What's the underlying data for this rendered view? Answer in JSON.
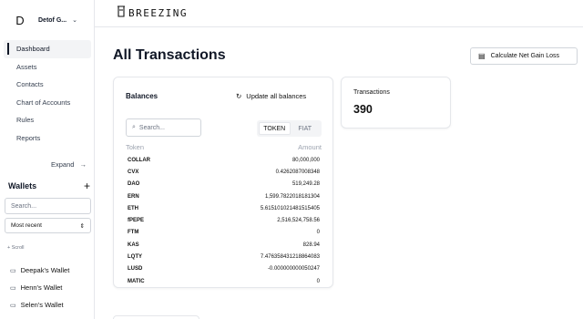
{
  "org": {
    "initial": "D",
    "name": "Detof G..."
  },
  "nav": [
    {
      "label": "Dashboard",
      "active": true
    },
    {
      "label": "Assets"
    },
    {
      "label": "Contacts"
    },
    {
      "label": "Chart of Accounts"
    },
    {
      "label": "Rules"
    },
    {
      "label": "Reports"
    }
  ],
  "sidebar": {
    "expand_label": "Expand",
    "wallets_title": "Wallets",
    "wallet_search_placeholder": "Search...",
    "sort_value": "Most recent",
    "scroll_hint": "+ Scroll",
    "wallets": [
      "Deepak's Wallet",
      "Henn's Wallet",
      "Selen's Wallet"
    ]
  },
  "brand": {
    "name": "BREEZING"
  },
  "main": {
    "title": "All Transactions",
    "calc_button": "Calculate Net Gain Loss"
  },
  "balances": {
    "title": "Balances",
    "update_label": "Update all balances",
    "search_placeholder": "Search...",
    "toggle": [
      "TOKEN",
      "FIAT"
    ],
    "toggle_selected": "TOKEN",
    "col_token": "Token",
    "col_amount": "Amount",
    "rows": [
      {
        "token": "COLLAR",
        "amount": "80,000,000"
      },
      {
        "token": "CVX",
        "amount": "0.4262087008348"
      },
      {
        "token": "DAO",
        "amount": "519,249.28"
      },
      {
        "token": "ERN",
        "amount": "1,599.7822018181304"
      },
      {
        "token": "ETH",
        "amount": "5.615101021481515405"
      },
      {
        "token": "fPEPE",
        "amount": "2,516,524,758.56"
      },
      {
        "token": "FTM",
        "amount": "0"
      },
      {
        "token": "KAS",
        "amount": "828.94"
      },
      {
        "token": "LQTY",
        "amount": "7.476358431218864083"
      },
      {
        "token": "LUSD",
        "amount": "-0.000000000050247"
      },
      {
        "token": "MATIC",
        "amount": "0"
      }
    ]
  },
  "transactions": {
    "label": "Transactions",
    "count": "390"
  }
}
